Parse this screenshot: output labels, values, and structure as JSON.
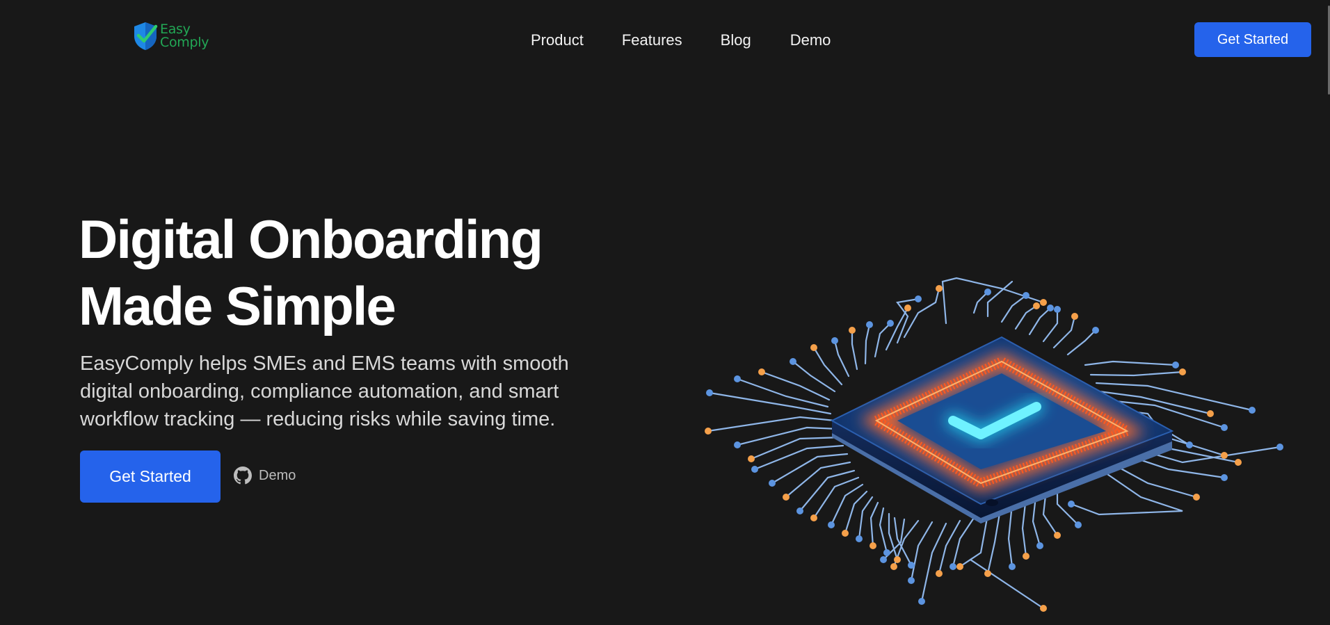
{
  "header": {
    "logo": {
      "line1": "Easy",
      "line2": "Comply",
      "icon": "shield-check-icon"
    },
    "nav": [
      {
        "label": "Product"
      },
      {
        "label": "Features"
      },
      {
        "label": "Blog"
      },
      {
        "label": "Demo"
      }
    ],
    "cta_label": "Get Started"
  },
  "hero": {
    "title_line1": "Digital Onboarding",
    "title_line2": "Made Simple",
    "description": "EasyComply helps SMEs and EMS teams with smooth digital onboarding, compliance automation, and smart workflow tracking — reducing risks while saving time.",
    "primary_cta": "Get Started",
    "secondary_cta": {
      "label": "Demo",
      "icon": "github-icon"
    },
    "illustration": "chip-checkmark-illustration"
  },
  "colors": {
    "background": "#181818",
    "accent": "#2563eb",
    "brand_green": "#22a755",
    "chip_glow": "#ff5a1f",
    "check_cyan": "#22d3ee"
  }
}
